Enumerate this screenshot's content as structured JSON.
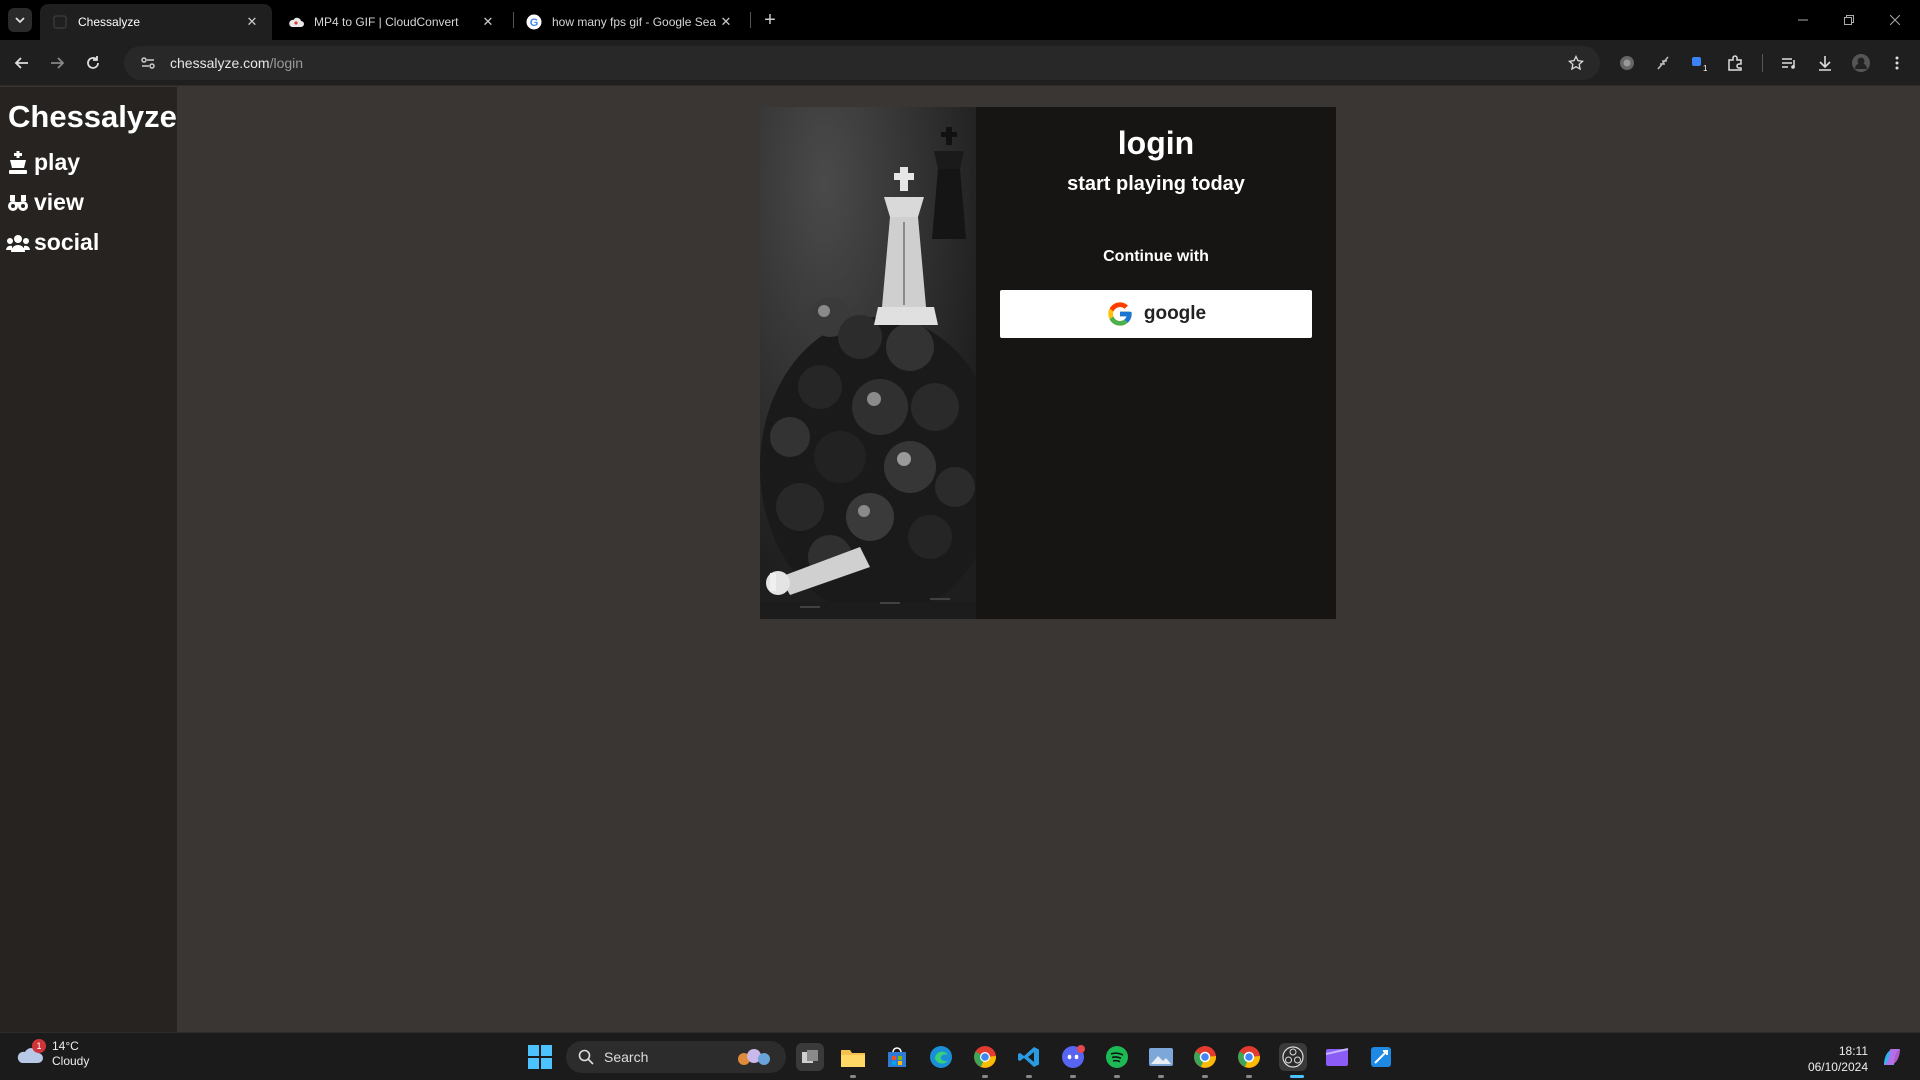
{
  "browser": {
    "tabs": [
      {
        "title": "Chessalyze",
        "active": true,
        "favicon": "chessalyze-favicon"
      },
      {
        "title": "MP4 to GIF | CloudConvert",
        "active": false,
        "favicon": "cloudconvert-icon"
      },
      {
        "title": "how many fps gif - Google Sea",
        "active": false,
        "favicon": "google-icon"
      }
    ],
    "url_host": "chessalyze.com",
    "url_path": "/login"
  },
  "sidebar": {
    "brand": "Chessalyze",
    "items": [
      {
        "label": "play",
        "icon": "chess-king-icon"
      },
      {
        "label": "view",
        "icon": "binoculars-icon"
      },
      {
        "label": "social",
        "icon": "users-icon"
      }
    ]
  },
  "login": {
    "title": "login",
    "subtitle": "start playing today",
    "continue_with": "Continue with",
    "google_label": "google",
    "art": "chess-pieces-illustration"
  },
  "taskbar": {
    "weather_temp": "14°C",
    "weather_desc": "Cloudy",
    "weather_badge": "1",
    "search_placeholder": "Search",
    "time": "18:11",
    "date": "06/10/2024"
  },
  "colors": {
    "page_bg": "#3a3633",
    "sidebar_bg": "#262321",
    "card_bg": "#171514",
    "button_bg": "#ffffff"
  }
}
